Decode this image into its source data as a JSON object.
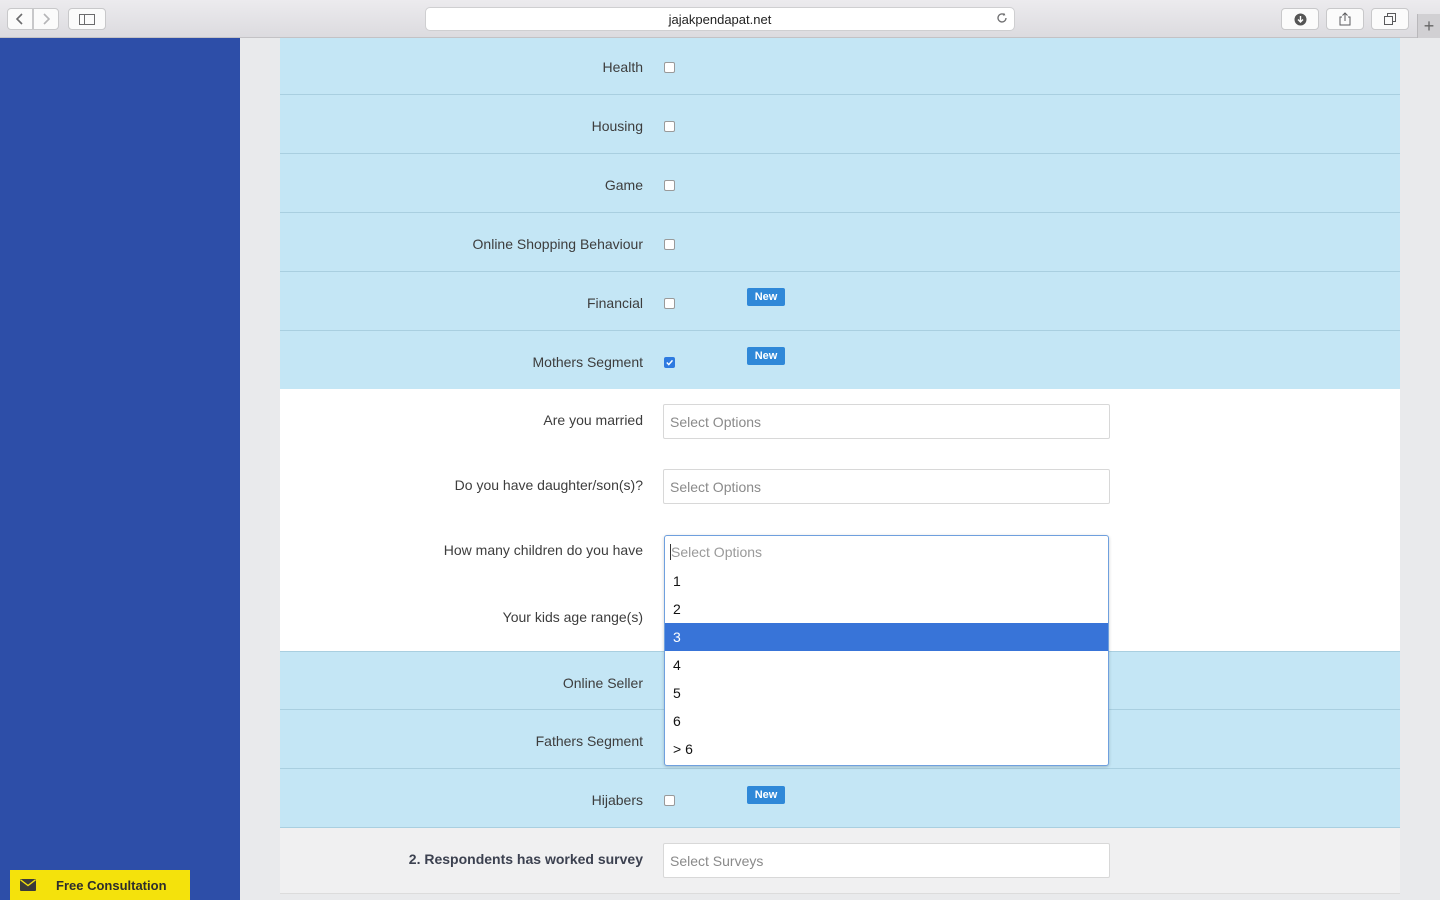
{
  "browser": {
    "url": "jajakpendapat.net"
  },
  "form": {
    "segments": [
      {
        "label": "Health",
        "checked": false,
        "badge": ""
      },
      {
        "label": "Housing",
        "checked": false,
        "badge": ""
      },
      {
        "label": "Game",
        "checked": false,
        "badge": ""
      },
      {
        "label": "Online Shopping Behaviour",
        "checked": false,
        "badge": ""
      },
      {
        "label": "Financial",
        "checked": false,
        "badge": "New"
      },
      {
        "label": "Mothers Segment",
        "checked": true,
        "badge": "New"
      }
    ],
    "mothers_questions": [
      {
        "label": "Are you married",
        "placeholder": "Select Options"
      },
      {
        "label": "Do you have daughter/son(s)?",
        "placeholder": "Select Options"
      },
      {
        "label": "How many children do you have",
        "placeholder": "Select Options"
      },
      {
        "label": "Your kids age range(s)",
        "placeholder": ""
      }
    ],
    "segments_after": [
      {
        "label": "Online Seller",
        "checked": false,
        "badge": ""
      },
      {
        "label": "Fathers Segment",
        "checked": false,
        "badge": ""
      },
      {
        "label": "Hijabers",
        "checked": false,
        "badge": "New"
      }
    ],
    "worked_survey": {
      "label": "2. Respondents has worked survey",
      "placeholder": "Select Surveys"
    }
  },
  "dropdown": {
    "placeholder": "Select Options",
    "options": [
      "1",
      "2",
      "3",
      "4",
      "5",
      "6",
      "> 6"
    ],
    "highlighted": "3"
  },
  "consultation": {
    "label": "Free Consultation"
  },
  "colors": {
    "sidebar": "#2d4ea8",
    "row_blue": "#c4e6f5",
    "badge": "#2f88d8",
    "highlight": "#3874d8",
    "consult": "#f4e20c"
  }
}
